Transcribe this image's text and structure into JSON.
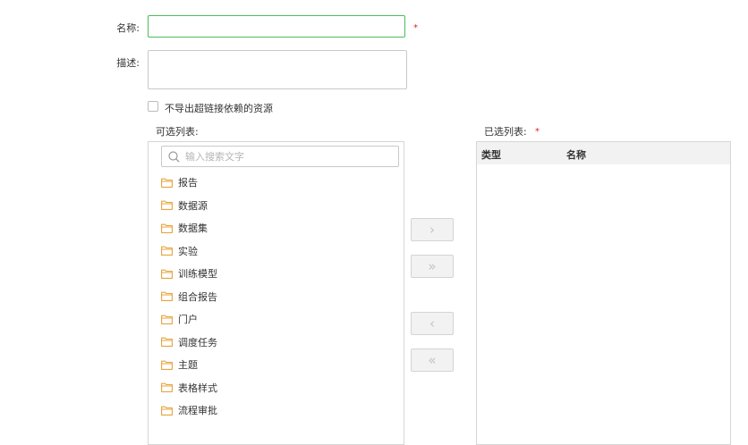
{
  "form": {
    "name_label": "名称:",
    "name_value": "",
    "desc_label": "描述:",
    "desc_value": "",
    "required_mark": "*",
    "checkbox_label": "不导出超链接依赖的资源",
    "checkbox_checked": false
  },
  "available": {
    "title": "可选列表:",
    "search_placeholder": "输入搜索文字",
    "items": [
      {
        "label": "报告",
        "icon": "folder-icon"
      },
      {
        "label": "数据源",
        "icon": "folder-icon"
      },
      {
        "label": "数据集",
        "icon": "folder-icon"
      },
      {
        "label": "实验",
        "icon": "folder-icon"
      },
      {
        "label": "训练模型",
        "icon": "folder-icon"
      },
      {
        "label": "组合报告",
        "icon": "folder-icon"
      },
      {
        "label": "门户",
        "icon": "folder-icon"
      },
      {
        "label": "调度任务",
        "icon": "folder-icon"
      },
      {
        "label": "主题",
        "icon": "folder-icon"
      },
      {
        "label": "表格样式",
        "icon": "folder-icon"
      },
      {
        "label": "流程审批",
        "icon": "folder-icon"
      }
    ]
  },
  "selected": {
    "title": "已选列表:",
    "columns": [
      "类型",
      "名称"
    ]
  },
  "transfer": {
    "add": "›",
    "add_all": "»",
    "remove": "‹",
    "remove_all": "«"
  },
  "colors": {
    "focus_border": "#4cbb5b",
    "required": "#e02424",
    "folder": "#e8a33d",
    "header_bg": "#f2f2f2"
  }
}
